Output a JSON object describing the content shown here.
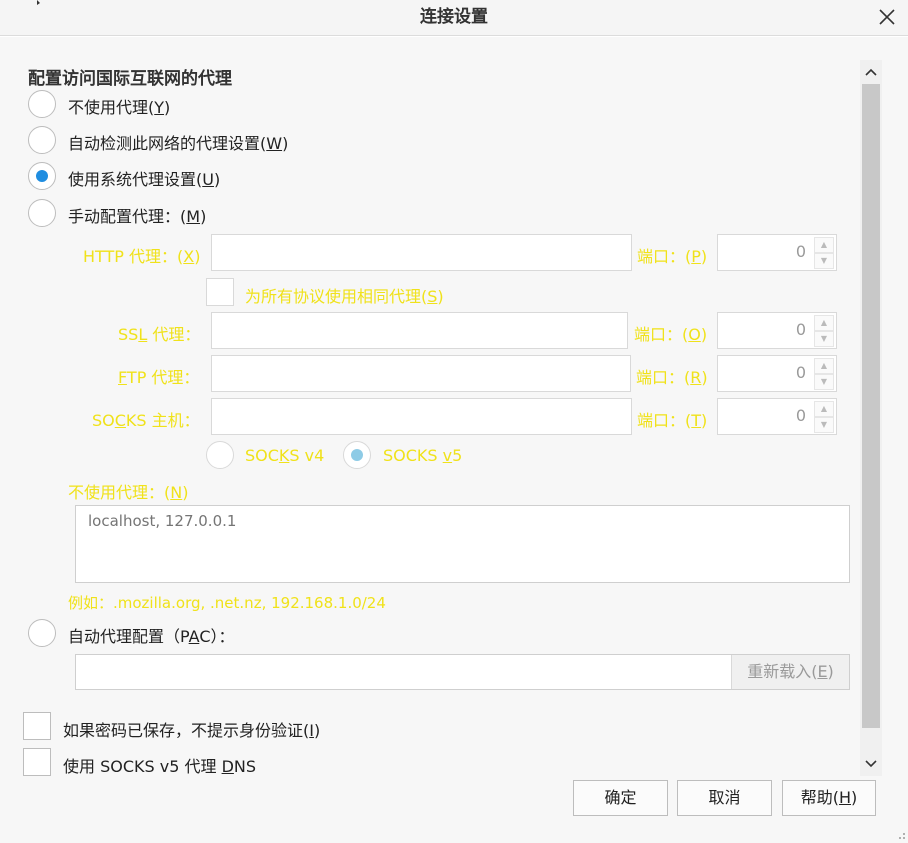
{
  "window": {
    "title": "连接设置"
  },
  "section": {
    "title": "配置访问国际互联网的代理"
  },
  "proxy_options": [
    {
      "label": "不使用代理(",
      "key": "Y",
      "suffix": ")",
      "selected": false
    },
    {
      "label": "自动检测此网络的代理设置(",
      "key": "W",
      "suffix": ")",
      "selected": false
    },
    {
      "label": "使用系统代理设置(",
      "key": "U",
      "suffix": ")",
      "selected": true
    },
    {
      "label": "手动配置代理：(",
      "key": "M",
      "suffix": ")",
      "selected": false
    }
  ],
  "manual": {
    "http_label": "HTTP 代理：(",
    "http_key": "X",
    "http_suffix": ")",
    "http_port_label": "端口：(",
    "http_port_key": "P",
    "http_port_suffix": ")",
    "http_port_value": "0",
    "same_proxy_label": "为所有协议使用相同代理(",
    "same_proxy_key": "S",
    "same_proxy_suffix": ")",
    "ssl_label_pre": "SS",
    "ssl_key": "L",
    "ssl_label_post": " 代理：",
    "ssl_port_label": "端口：(",
    "ssl_port_key": "O",
    "ssl_port_suffix": ")",
    "ssl_port_value": "0",
    "ftp_key": "F",
    "ftp_label_post": "TP 代理：",
    "ftp_port_label": "端口：(",
    "ftp_port_key": "R",
    "ftp_port_suffix": ")",
    "ftp_port_value": "0",
    "socks_label_pre": "SO",
    "socks_key": "C",
    "socks_label_post": "KS 主机：",
    "socks_port_label": "端口：(",
    "socks_port_key": "T",
    "socks_port_suffix": ")",
    "socks_port_value": "0",
    "socks_v4_pre": "SOC",
    "socks_v4_key": "K",
    "socks_v4_post": "S v4",
    "socks_v5_pre": "SOCKS ",
    "socks_v5_key": "v",
    "socks_v5_post": "5",
    "socks_v5_selected": true
  },
  "no_proxy": {
    "label": "不使用代理：(",
    "key": "N",
    "suffix": ")",
    "placeholder": "localhost, 127.0.0.1",
    "example": "例如：.mozilla.org, .net.nz, 192.168.1.0/24"
  },
  "pac": {
    "label_pre": "自动代理配置（P",
    "key": "A",
    "label_post": "C）：",
    "reload_pre": "重新载入(",
    "reload_key": "E",
    "reload_suffix": ")"
  },
  "checkboxes": {
    "no_auth_pre": "如果密码已保存，不提示身份验证(",
    "no_auth_key": "I",
    "no_auth_suffix": ")",
    "socks_dns_pre": "使用 SOCKS v5 代理 ",
    "socks_dns_key": "D",
    "socks_dns_post": "NS"
  },
  "buttons": {
    "ok": "确定",
    "cancel": "取消",
    "help_pre": "帮助(",
    "help_key": "H",
    "help_suffix": ")"
  },
  "icons": {
    "close": "close-icon",
    "scroll_up": "chevron-up-icon",
    "scroll_down": "chevron-down-icon",
    "spin_up": "spin-up-icon",
    "spin_down": "spin-down-icon",
    "resize": "resize-grip-icon"
  },
  "colors": {
    "accent": "#1f8de0",
    "disabled_text": "#f0e21a"
  }
}
